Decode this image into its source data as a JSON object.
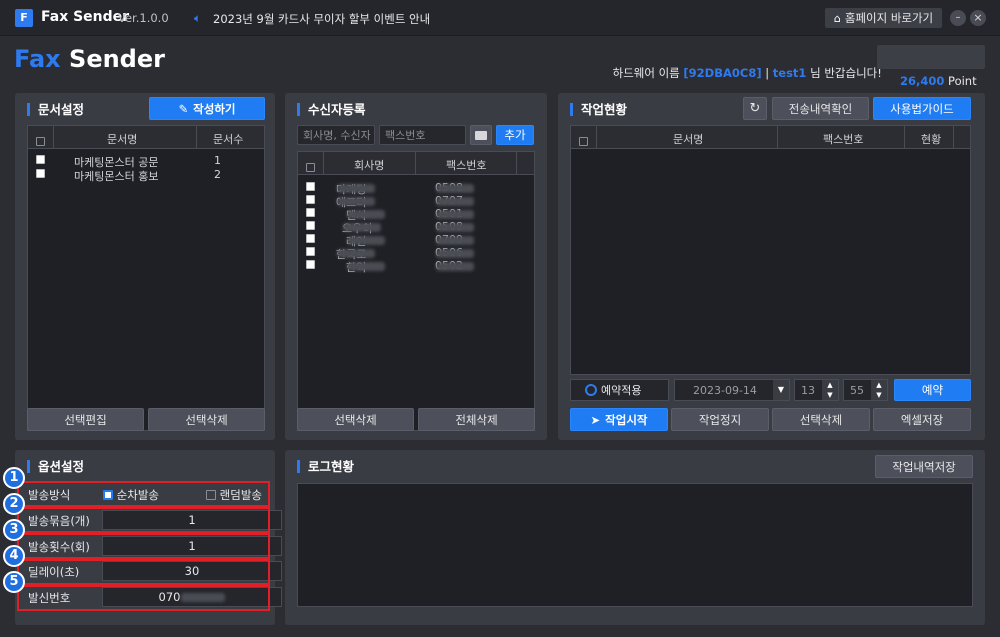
{
  "titlebar": {
    "logo": "F",
    "app_name": "Fax Sender",
    "version": "Ver.1.0.0",
    "notice": "2023년 9월 카드사 무이자 할부 이벤트 안내",
    "homepage_btn": "홈페이지 바로가기",
    "min": "–",
    "close": "×"
  },
  "header": {
    "brand_fax": "Fax",
    "brand_sender": " Sender",
    "hw_label": "하드웨어 이름",
    "hw_id": "[92DBA0C8]",
    "sep": "|",
    "user": "test1",
    "greet": "님 반갑습니다!",
    "points": "26,400",
    "points_unit": "Point"
  },
  "doc": {
    "title": "문서설정",
    "write_btn": "작성하기",
    "col_name": "문서명",
    "col_count": "문서수",
    "rows": [
      {
        "name": "마케팅몬스터 공문",
        "count": "1"
      },
      {
        "name": "마케팅몬스터 홍보",
        "count": "2"
      }
    ],
    "edit_btn": "선택편집",
    "delete_btn": "선택삭제"
  },
  "recv": {
    "title": "수신자등록",
    "name_placeholder": "회사명, 수신자",
    "fax_placeholder": "팩스번호",
    "add_btn": "추가",
    "col_company": "회사명",
    "col_fax": "팩스번호",
    "rows": [
      {
        "company": "마케팅",
        "fax": "0508"
      },
      {
        "company": "에프터",
        "fax": "0707"
      },
      {
        "company": "멘시",
        "fax": "0501"
      },
      {
        "company": "오우히",
        "fax": "0508"
      },
      {
        "company": "레인",
        "fax": "0709"
      },
      {
        "company": "한국로",
        "fax": "0506"
      },
      {
        "company": "한익",
        "fax": "0502"
      }
    ],
    "delete_btn": "선택삭제",
    "delete_all_btn": "전체삭제"
  },
  "work": {
    "title": "작업현황",
    "history_btn": "전송내역확인",
    "guide_btn": "사용법가이드",
    "col_doc": "문서명",
    "col_fax": "팩스번호",
    "col_status": "현황",
    "reserve_label": "예약적용",
    "date": "2023-09-14",
    "hour": "13",
    "minute": "55",
    "reserve_btn": "예약",
    "start_btn": "작업시작",
    "stop_btn": "작업정지",
    "delete_btn": "선택삭제",
    "excel_btn": "엑셀저장"
  },
  "options": {
    "title": "옵션설정",
    "send_method_label": "발송방식",
    "seq": "순차발송",
    "random": "랜덤발송",
    "rows": [
      {
        "label": "발송묶음(개)",
        "value": "1"
      },
      {
        "label": "발송횟수(회)",
        "value": "1"
      },
      {
        "label": "딜레이(초)",
        "value": "30"
      },
      {
        "label": "발신번호",
        "value": "070"
      }
    ],
    "badges": [
      "1",
      "2",
      "3",
      "4",
      "5"
    ]
  },
  "log": {
    "title": "로그현황",
    "save_btn": "작업내역저장"
  },
  "colors": {
    "accent": "#1f7cf2",
    "panel": "#3a3c44",
    "highlight": "#e01f26"
  }
}
